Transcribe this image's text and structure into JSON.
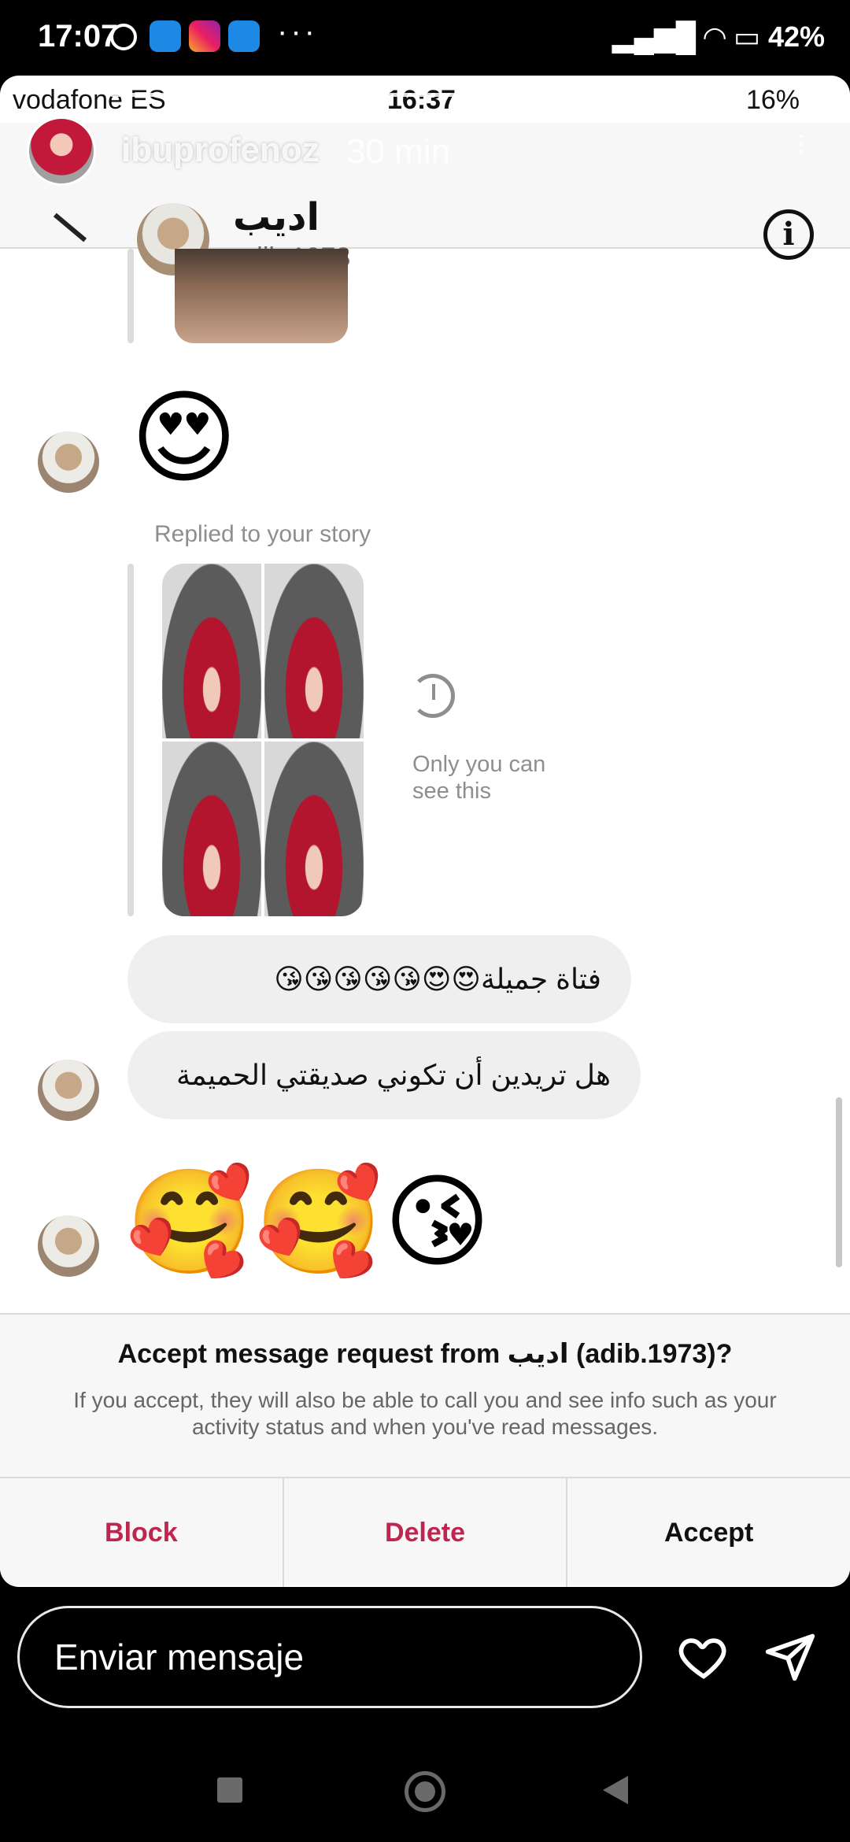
{
  "outer_status": {
    "time": "17:07",
    "more": "···",
    "battery": "42%"
  },
  "inner_status": {
    "carrier": "vodafone ES",
    "time": "16:37",
    "battery": "16%"
  },
  "story": {
    "username": "ibuprofenoz",
    "posted_ago": "30 min"
  },
  "chat": {
    "name": "اديب",
    "handle": "adib.1973"
  },
  "messages": {
    "emoji_1": "😍",
    "replied_label": "Replied to your story",
    "only_you": "Only you can see this",
    "text_1": "فتاة جميلة😍😍😘😘😘😘😘",
    "text_2": "هل تريدين أن تكوني صديقتي الحميمة",
    "emoji_2": "🥰🥰😘"
  },
  "request": {
    "title": "Accept message request from اديب (adib.1973)?",
    "description": "If you accept, they will also be able to call you and see info such as your activity status and when you've read messages.",
    "block_label": "Block",
    "delete_label": "Delete",
    "accept_label": "Accept",
    "danger_color": "#c1244e"
  },
  "reply_bar": {
    "placeholder": "Enviar mensaje"
  }
}
